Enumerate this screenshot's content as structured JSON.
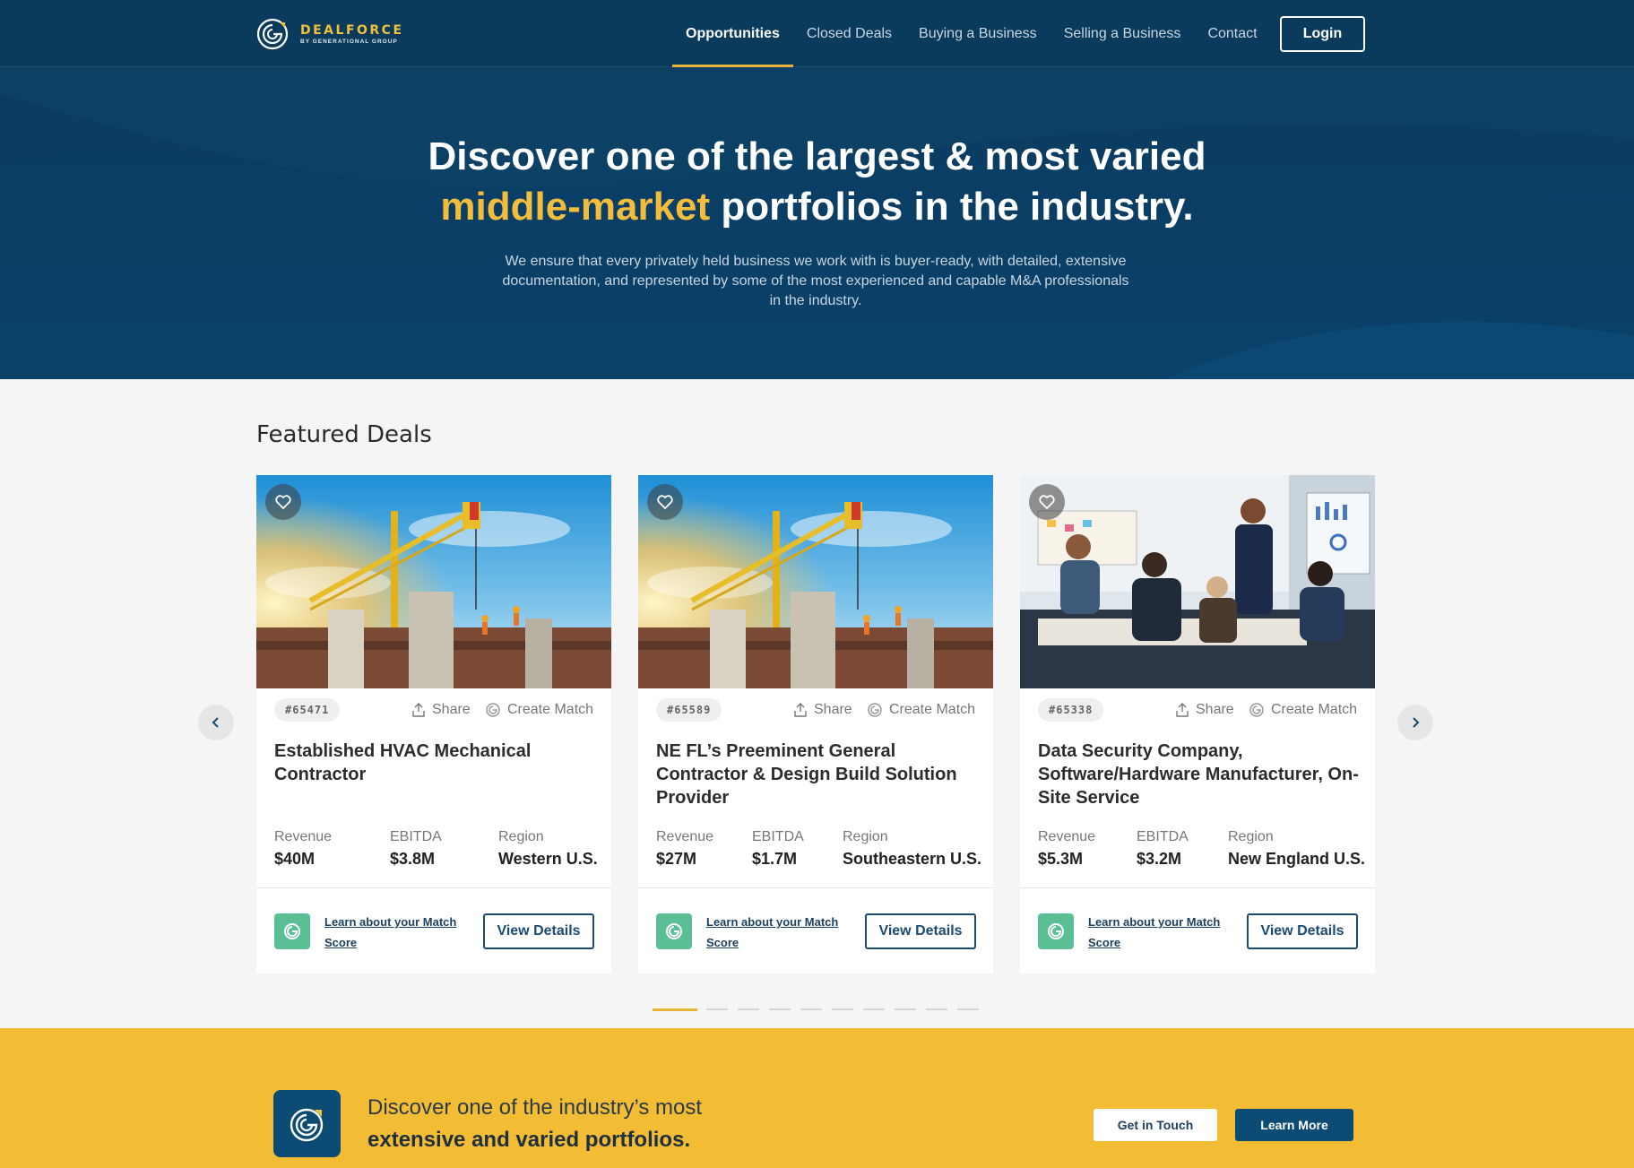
{
  "header": {
    "logo_brand": "DEALFORCE",
    "logo_sub": "BY GENERATIONAL GROUP",
    "nav": [
      {
        "label": "Opportunities",
        "active": true
      },
      {
        "label": "Closed Deals"
      },
      {
        "label": "Buying a Business"
      },
      {
        "label": "Selling a Business"
      },
      {
        "label": "Contact"
      }
    ],
    "login_label": "Login"
  },
  "hero": {
    "title_line1": "Discover one of the largest & most varied",
    "title_accent": "middle-market",
    "title_line2_rest": " portfolios in the industry.",
    "description": "We ensure that every privately held business we work with is buyer-ready, with detailed, extensive documentation, and represented by some of the most experienced and capable M&A professionals in the industry."
  },
  "featured": {
    "title": "Featured Deals",
    "share_label": "Share",
    "create_match_label": "Create Match",
    "match_link_label": "Learn about your Match Score",
    "details_label": "View Details",
    "metric_labels": {
      "revenue": "Revenue",
      "ebitda": "EBITDA",
      "region": "Region"
    },
    "cards": [
      {
        "id": "#65471",
        "title": "Established HVAC Mechanical Contractor",
        "revenue": "$40M",
        "ebitda": "$3.8M",
        "region": "Western U.S.",
        "image": "construction-crane"
      },
      {
        "id": "#65589",
        "title": "NE FL’s Preeminent General Contractor & Design Build Solution Provider",
        "revenue": "$27M",
        "ebitda": "$1.7M",
        "region": "Southeastern U.S.",
        "image": "construction-crane"
      },
      {
        "id": "#65338",
        "title": "Data Security Company, Software/Hardware Manufacturer, On-Site Service",
        "revenue": "$5.3M",
        "ebitda": "$3.2M",
        "region": "New England U.S.",
        "image": "office-meeting"
      }
    ],
    "pagination_count": 10,
    "pagination_active": 1
  },
  "cta": {
    "line1": "Discover one of the industry’s most",
    "line2": "extensive and varied portfolios.",
    "btn_touch": "Get in Touch",
    "btn_learn": "Learn More"
  },
  "colors": {
    "navy": "#0a3a5c",
    "gold": "#f3bc35",
    "accent_gold": "#f2bc3d",
    "match_green": "#5bbf95"
  }
}
